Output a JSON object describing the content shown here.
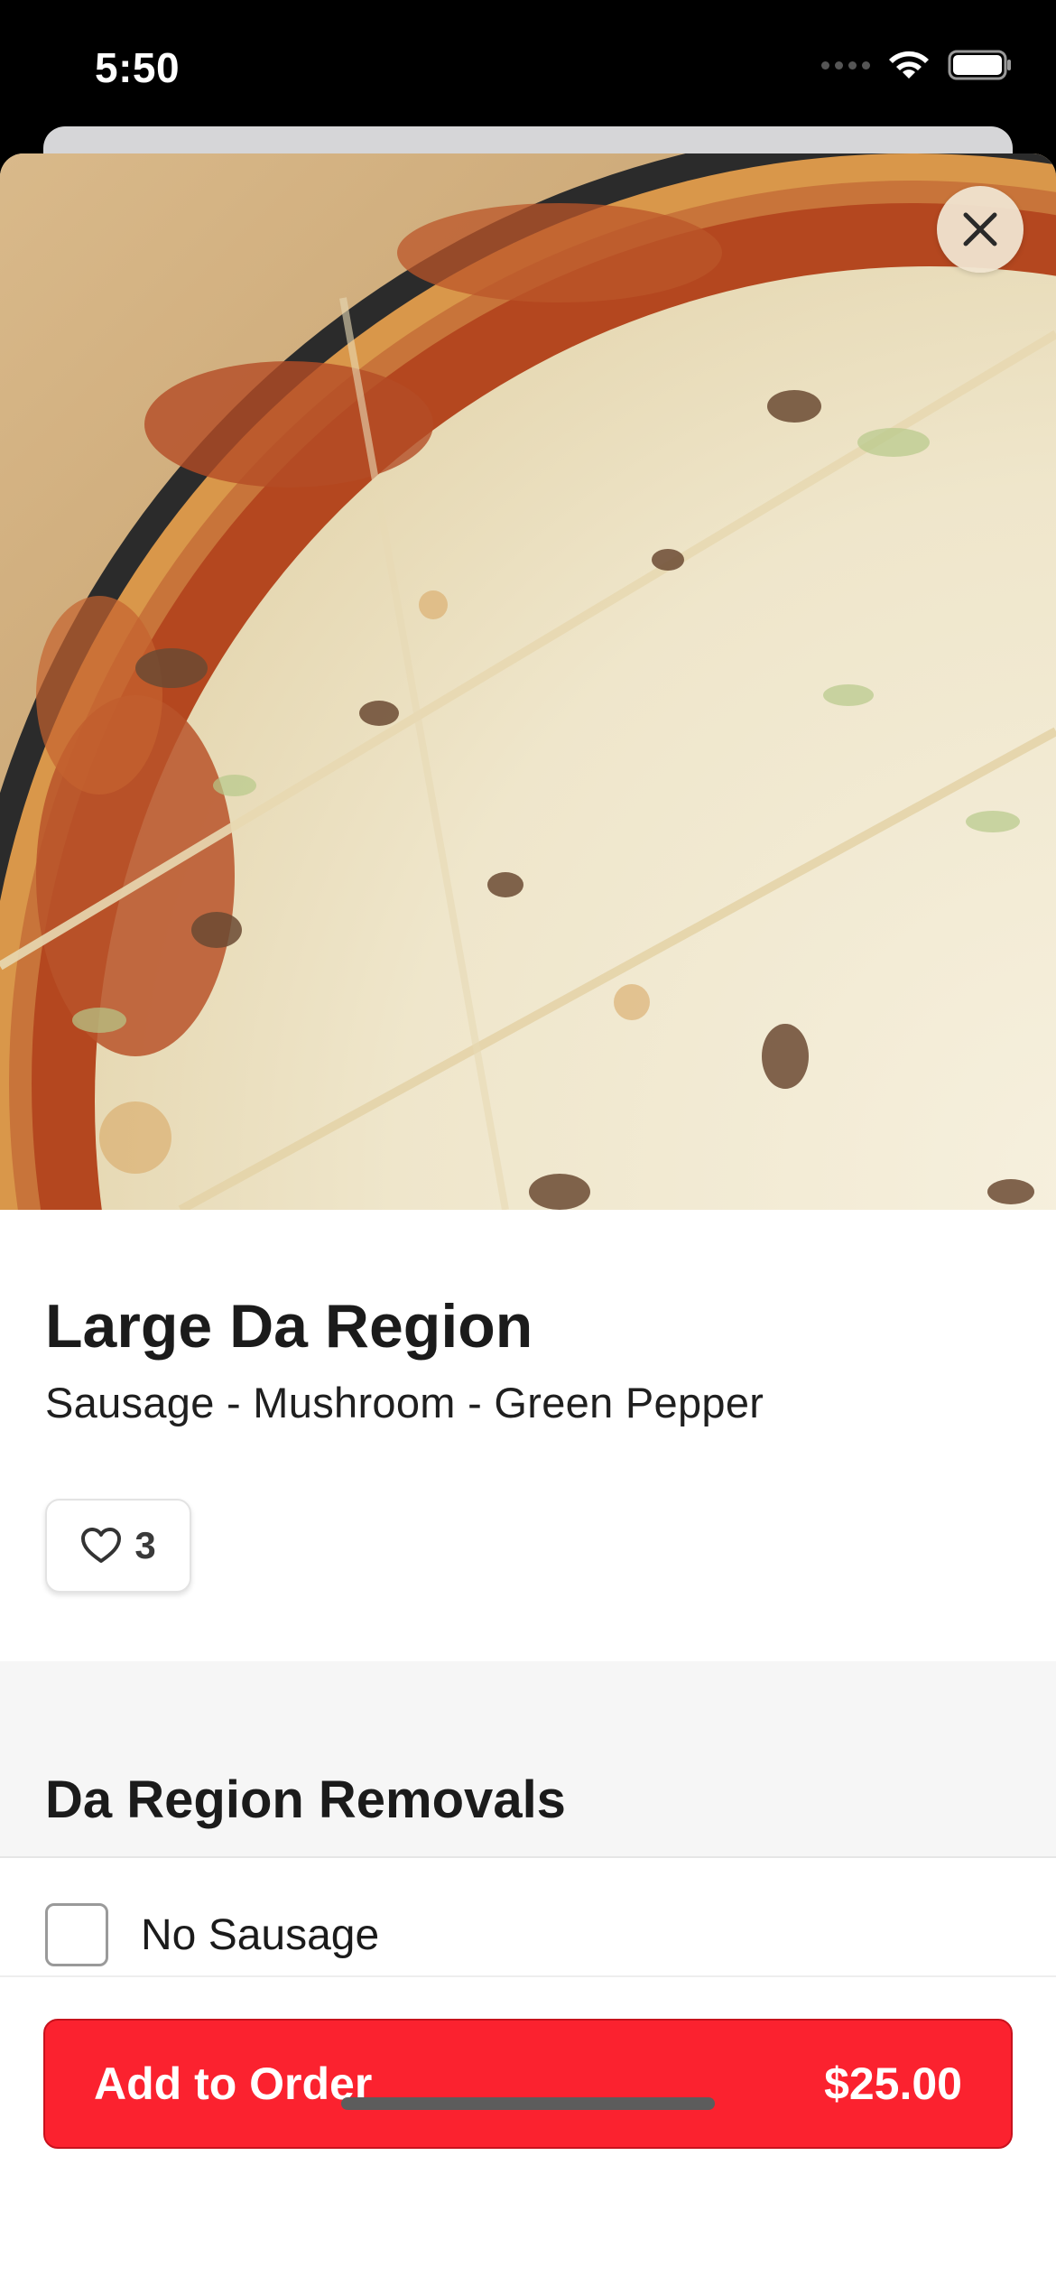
{
  "status_bar": {
    "time": "5:50"
  },
  "close": {
    "icon": "close-icon"
  },
  "item": {
    "title": "Large Da Region",
    "description": "Sausage - Mushroom - Green Pepper",
    "like_icon": "heart-icon",
    "like_count": "3"
  },
  "section": {
    "title": "Da Region Removals",
    "options": [
      {
        "label": "No Sausage",
        "checked": false
      }
    ]
  },
  "cta": {
    "label": "Add to Order",
    "price": "$25.00"
  },
  "colors": {
    "accent": "#fb222f",
    "section_bg": "#f6f6f6"
  }
}
